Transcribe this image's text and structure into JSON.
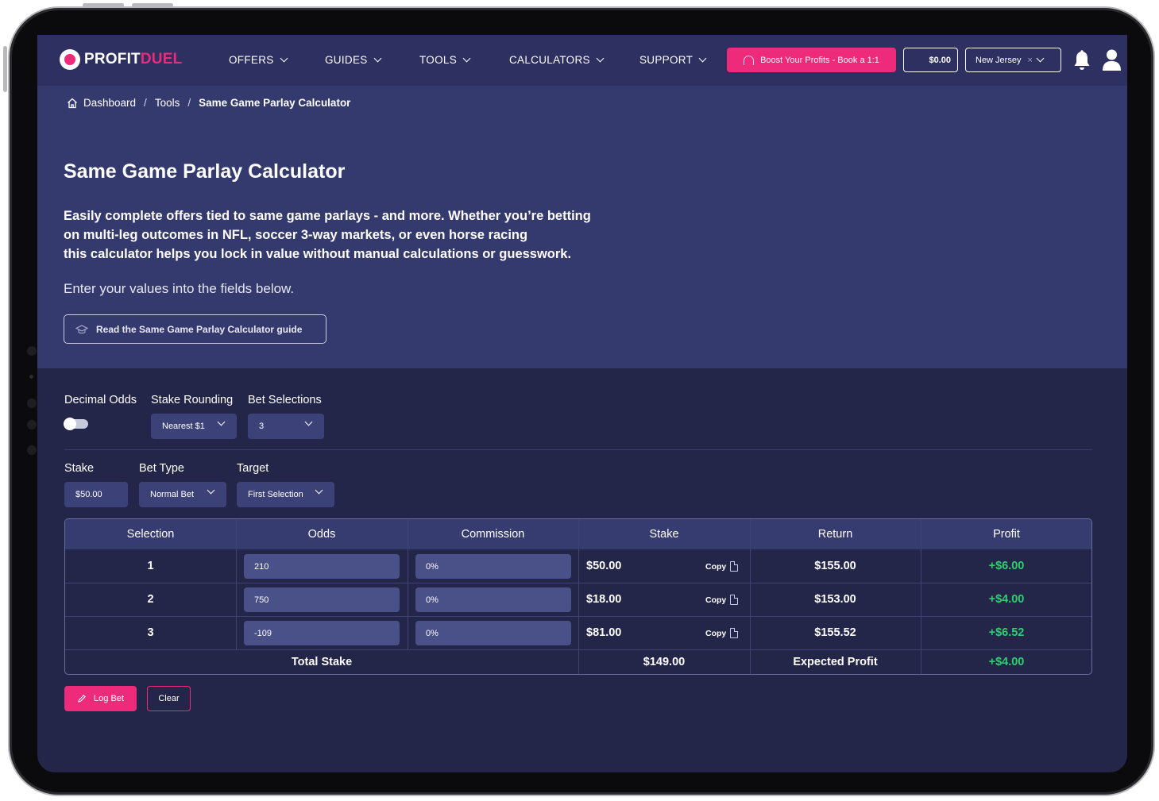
{
  "brand": {
    "logo_white": "PROFIT",
    "logo_pink": "DUEL",
    "accent_color": "#ee2a7b",
    "nav_bg": "#2d3060",
    "hero_bg": "#353a6e",
    "page_bg": "#232649"
  },
  "nav": {
    "items": [
      {
        "label": "OFFERS"
      },
      {
        "label": "GUIDES"
      },
      {
        "label": "TOOLS"
      },
      {
        "label": "CALCULATORS"
      },
      {
        "label": "SUPPORT"
      }
    ],
    "boost_label": "Boost Your Profits - Book a 1:1",
    "balance": "$0.00",
    "state": "New Jersey",
    "state_clear": "×"
  },
  "breadcrumb": {
    "home": "Dashboard",
    "section": "Tools",
    "current": "Same Game Parlay Calculator",
    "separator": "/"
  },
  "hero": {
    "title": "Same Game Parlay Calculator",
    "desc_lines": [
      "Easily complete offers tied to same game parlays - and more. Whether you’re betting",
      "on multi-leg outcomes in NFL, soccer 3-way markets, or even horse racing",
      "this calculator helps you lock in value without manual calculations or guesswork."
    ],
    "sub": "Enter your values into the fields below.",
    "guide_button": "Read the Same Game Parlay Calculator guide"
  },
  "settings": {
    "decimal_odds_label": "Decimal Odds",
    "decimal_odds_on": false,
    "stake_rounding_label": "Stake Rounding",
    "stake_rounding_value": "Nearest $1",
    "bet_selections_label": "Bet Selections",
    "bet_selections_value": "3",
    "stake_label": "Stake",
    "stake_value": "$50.00",
    "bet_type_label": "Bet Type",
    "bet_type_value": "Normal Bet",
    "target_label": "Target",
    "target_value": "First Selection"
  },
  "table": {
    "headers": [
      "Selection",
      "Odds",
      "Commission",
      "Stake",
      "Return",
      "Profit"
    ],
    "copy_label": "Copy",
    "rows": [
      {
        "selection": "1",
        "odds": "210",
        "commission": "0%",
        "stake": "$50.00",
        "return": "$155.00",
        "profit": "+$6.00"
      },
      {
        "selection": "2",
        "odds": "750",
        "commission": "0%",
        "stake": "$18.00",
        "return": "$153.00",
        "profit": "+$4.00"
      },
      {
        "selection": "3",
        "odds": "-109",
        "commission": "0%",
        "stake": "$81.00",
        "return": "$155.52",
        "profit": "+$6.52"
      }
    ],
    "total_stake_label": "Total Stake",
    "total_stake": "$149.00",
    "expected_profit_label": "Expected Profit",
    "expected_profit": "+$4.00"
  },
  "actions": {
    "log_bet": "Log Bet",
    "clear": "Clear"
  }
}
